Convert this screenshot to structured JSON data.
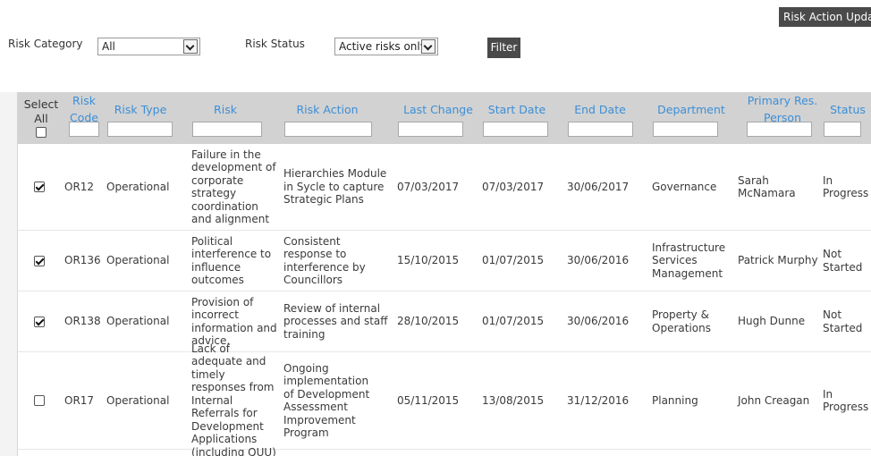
{
  "header": {
    "action_button": "Risk Action Update"
  },
  "filters": {
    "category_label": "Risk Category",
    "category_value": "All",
    "status_label": "Risk Status",
    "status_value": "Active risks only",
    "filter_button": "Filter"
  },
  "table": {
    "select_label": "Select All",
    "columns": [
      "Risk Code",
      "Risk Type",
      "Risk",
      "Risk Action",
      "Last Change",
      "Start Date",
      "End Date",
      "Department",
      "Primary Res. Person",
      "Status"
    ],
    "rows": [
      {
        "checked": true,
        "code": "OR12",
        "type": "Operational",
        "risk": "Failure in the development of corporate strategy coordination and alignment",
        "action": "Hierarchies Module in Sycle to capture Strategic Plans",
        "last_change": "07/03/2017",
        "start": "07/03/2017",
        "end": "30/06/2017",
        "department": "Governance",
        "person": "Sarah McNamara",
        "status": "In Progress"
      },
      {
        "checked": true,
        "code": "OR136",
        "type": "Operational",
        "risk": "Political interference to influence outcomes",
        "action": "Consistent response to interference by Councillors",
        "last_change": "15/10/2015",
        "start": "01/07/2015",
        "end": "30/06/2016",
        "department": "Infrastructure Services Management",
        "person": "Patrick Murphy",
        "status": "Not Started"
      },
      {
        "checked": true,
        "code": "OR138",
        "type": "Operational",
        "risk": "Provision of incorrect information and advice.",
        "action": "Review of internal processes and staff training",
        "last_change": "28/10/2015",
        "start": "01/07/2015",
        "end": "30/06/2016",
        "department": "Property & Operations",
        "person": "Hugh Dunne",
        "status": "Not Started"
      },
      {
        "checked": false,
        "code": "OR17",
        "type": "Operational",
        "risk": "Lack of adequate and timely responses from Internal Referrals for Development Applications (including QUU)",
        "action": "Ongoing implementation of Development Assessment Improvement Program",
        "last_change": "05/11/2015",
        "start": "13/08/2015",
        "end": "31/12/2016",
        "department": "Planning",
        "person": "John Creagan",
        "status": "In Progress"
      }
    ]
  }
}
